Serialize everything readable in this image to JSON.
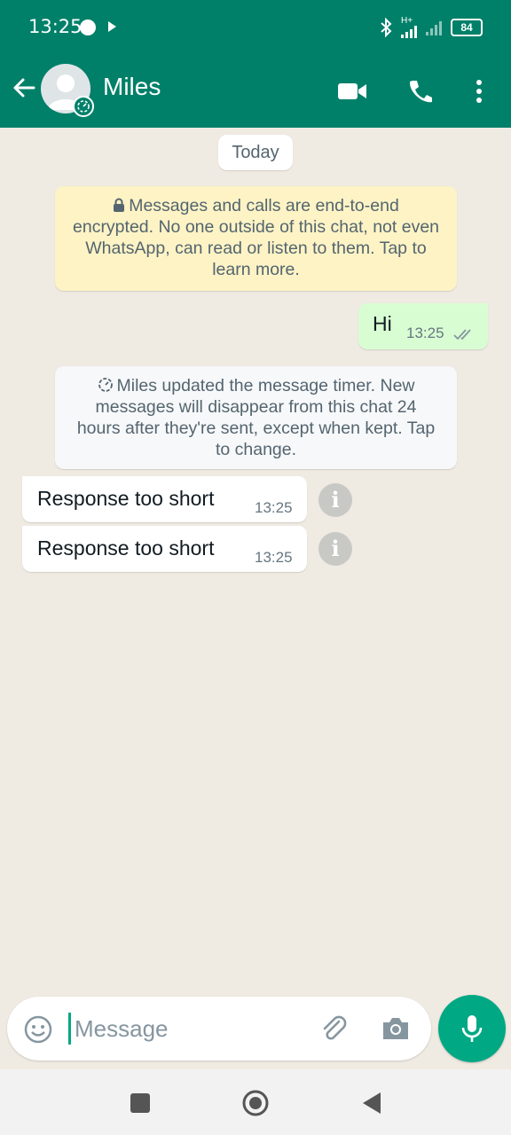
{
  "colors": {
    "header": "#008069",
    "chat_background": "#efeae2",
    "outgoing_bubble": "#d9fdd3",
    "incoming_bubble": "#ffffff",
    "encryption_note": "#fdf3c5",
    "accent": "#00a884"
  },
  "status_bar": {
    "time": "13:25",
    "network": "H+",
    "battery": "84",
    "icons": [
      "notification-dot-icon",
      "play-icon",
      "bluetooth-icon",
      "signal-icon",
      "battery-icon"
    ]
  },
  "header": {
    "back_icon": "arrow-left-icon",
    "contact_name": "Miles",
    "avatar_icon": "default-avatar-icon",
    "avatar_badge_icon": "disappearing-timer-icon",
    "actions": [
      "video-call-icon",
      "voice-call-icon",
      "more-vertical-icon"
    ]
  },
  "chat": {
    "date_chip": "Today",
    "encryption_notice": {
      "icon": "lock-icon",
      "text": "Messages and calls are end-to-end encrypted. No one outside of this chat, not even WhatsApp, can read or listen to them. Tap to learn more."
    },
    "outgoing_message": {
      "text": "Hi",
      "time": "13:25",
      "status_icon": "double-check-icon"
    },
    "timer_notice": {
      "icon": "timer-icon",
      "text": "Miles updated the message timer. New messages will disappear from this chat 24 hours after they're sent, except when kept. Tap to change."
    },
    "incoming_messages": [
      {
        "text": "Response too short",
        "time": "13:25",
        "icon": "info-icon"
      },
      {
        "text": "Response too short",
        "time": "13:25",
        "icon": "info-icon"
      }
    ]
  },
  "composer": {
    "emoji_icon": "emoji-icon",
    "placeholder": "Message",
    "value": "",
    "attach_icon": "paperclip-icon",
    "camera_icon": "camera-icon",
    "mic_icon": "microphone-icon"
  },
  "nav_bar": {
    "buttons": [
      "recents-square-icon",
      "home-circle-icon",
      "back-triangle-icon"
    ]
  }
}
